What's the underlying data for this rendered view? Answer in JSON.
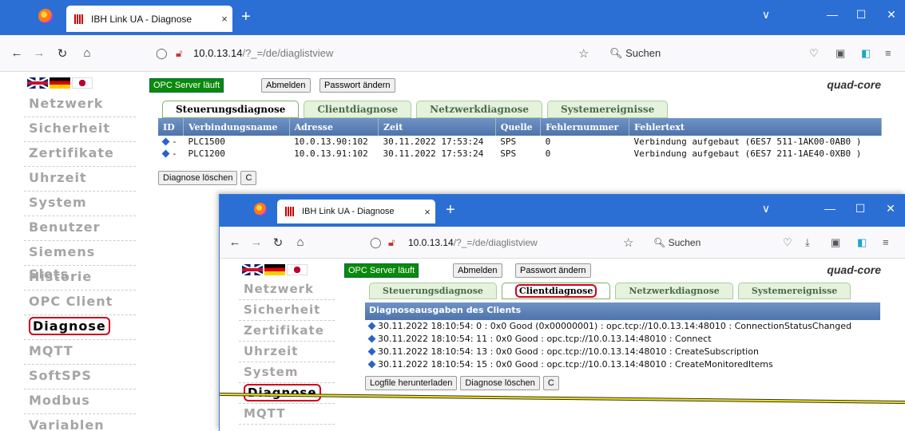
{
  "browser": {
    "tab_title": "IBH Link UA - Diagnose",
    "tab_close": "×",
    "new_tab": "+",
    "window_controls": [
      "∨",
      "—",
      "☐",
      "✕"
    ],
    "url_host": "10.0.13.14",
    "url_path": "/?_=/de/diaglistview",
    "search_placeholder": "Suchen"
  },
  "header": {
    "status": "OPC Server läuft",
    "logout": "Abmelden",
    "change_password": "Passwort ändern",
    "brand": "quad-core"
  },
  "sidebar1": [
    "Netzwerk",
    "Sicherheit",
    "Zertifikate",
    "Uhrzeit",
    "System",
    "Benutzer",
    "Siemens Slots",
    "Historie",
    "OPC Client",
    "Diagnose",
    "MQTT",
    "SoftSPS",
    "Modbus",
    "Variablen"
  ],
  "sidebar2": [
    "Netzwerk",
    "Sicherheit",
    "Zertifikate",
    "Uhrzeit",
    "System",
    "Diagnose",
    "MQTT"
  ],
  "tabs": [
    "Steuerungsdiagnose",
    "Clientdiagnose",
    "Netzwerkdiagnose",
    "Systemereignisse"
  ],
  "table": {
    "headers": [
      "ID",
      "Verbindungsname",
      "Adresse",
      "Zeit",
      "Quelle",
      "Fehlernummer",
      "Fehlertext"
    ],
    "rows": [
      [
        "-",
        "PLC1500",
        "10.0.13.90:102",
        "30.11.2022 17:53:24",
        "SPS",
        "0",
        "Verbindung aufgebaut (6ES7 511-1AK00-0AB0 )"
      ],
      [
        "-",
        "PLC1200",
        "10.0.13.91:102",
        "30.11.2022 17:53:24",
        "SPS",
        "0",
        "Verbindung aufgebaut (6ES7 211-1AE40-0XB0 )"
      ]
    ]
  },
  "buttons": {
    "clear": "Diagnose löschen",
    "refresh": "C",
    "download_log": "Logfile herunterladen"
  },
  "client_log": {
    "title": "Diagnoseausgaben des Clients",
    "lines": [
      "30.11.2022 18:10:54: 0 : 0x0 Good (0x00000001) : opc.tcp://10.0.13.14:48010 : ConnectionStatusChanged",
      "30.11.2022 18:10:54: 11 : 0x0 Good : opc.tcp://10.0.13.14:48010 : Connect",
      "30.11.2022 18:10:54: 13 : 0x0 Good : opc.tcp://10.0.13.14:48010 : CreateSubscription",
      "30.11.2022 18:10:54: 15 : 0x0 Good : opc.tcp://10.0.13.14:48010 : CreateMonitoredItems"
    ]
  },
  "colors": {
    "tabbar": "#2b6fd4",
    "status_green": "#0a8a0a",
    "highlight_red": "#d0021b",
    "table_header": "#5b7fb5"
  }
}
